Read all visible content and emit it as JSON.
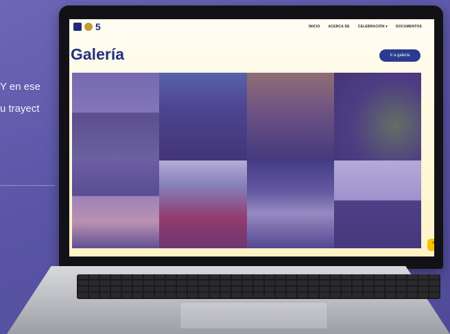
{
  "background_text": {
    "line1": "Y en ese",
    "line2": "u trayect"
  },
  "nav": {
    "logo_text": "5",
    "links": [
      "INICIO",
      "ACERCA DE",
      "CELEBRACIÓN ▾",
      "DOCUMENTOS"
    ]
  },
  "page": {
    "title": "Galería",
    "button_label": "Ir a galería"
  },
  "scroll_top": {
    "icon": "chevron-up-icon",
    "glyph": "⌃",
    "color": "#f4c400"
  },
  "colors": {
    "accent": "#26307f",
    "screen_bg": "#fff8da"
  }
}
